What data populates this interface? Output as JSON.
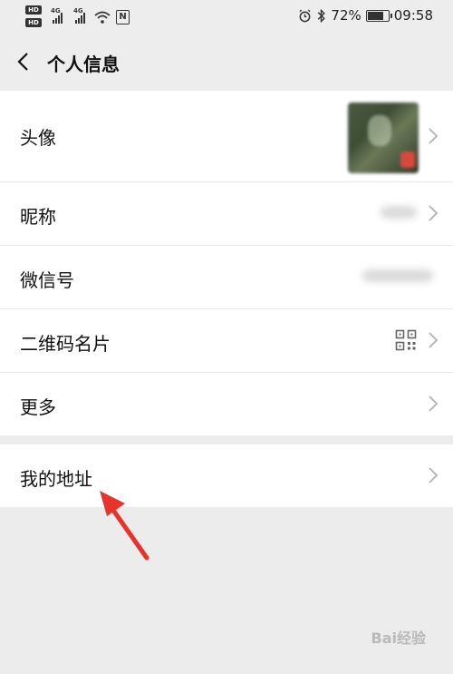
{
  "status_bar": {
    "hd1": "HD",
    "hd2": "HD",
    "net1": "4G",
    "net2": "4G",
    "nfc": "N",
    "battery": "72%",
    "time": "09:58"
  },
  "nav": {
    "title": "个人信息"
  },
  "rows": {
    "avatar": "头像",
    "nickname": "昵称",
    "wechat_id": "微信号",
    "qr_card": "二维码名片",
    "more": "更多",
    "address": "我的地址"
  },
  "watermark": "Bai经验",
  "colors": {
    "background": "#ececec",
    "row_bg": "#ffffff",
    "arrow": "#e8332a"
  }
}
